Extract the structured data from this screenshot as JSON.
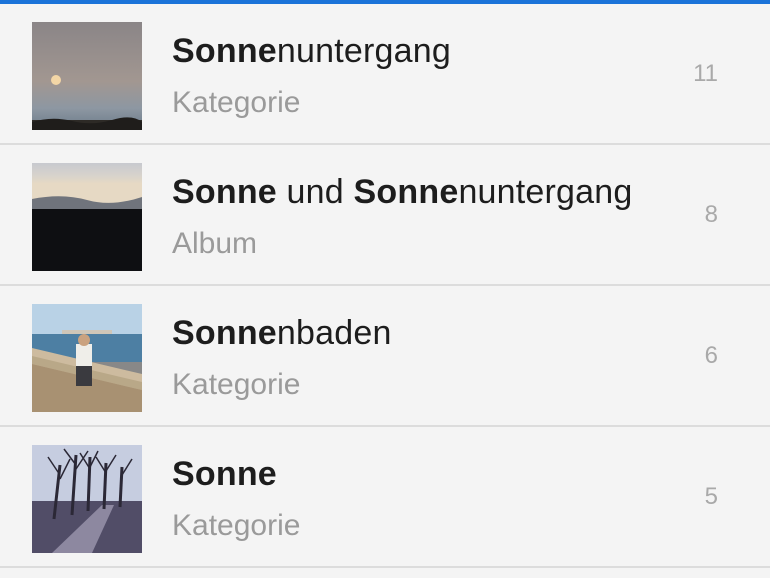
{
  "results": [
    {
      "title_parts": [
        {
          "text": "Sonne",
          "bold": true
        },
        {
          "text": "nuntergang",
          "bold": false
        }
      ],
      "subtitle": "Kategorie",
      "count": "11",
      "thumbnail": "sunset-moon-photo"
    },
    {
      "title_parts": [
        {
          "text": "Sonne",
          "bold": true
        },
        {
          "text": " und ",
          "bold": false
        },
        {
          "text": "Sonne",
          "bold": true
        },
        {
          "text": "nuntergang",
          "bold": false
        }
      ],
      "subtitle": "Album",
      "count": "8",
      "thumbnail": "dusk-landscape-photo"
    },
    {
      "title_parts": [
        {
          "text": "Sonne",
          "bold": true
        },
        {
          "text": "nbaden",
          "bold": false
        }
      ],
      "subtitle": "Kategorie",
      "count": "6",
      "thumbnail": "seaside-person-photo"
    },
    {
      "title_parts": [
        {
          "text": "Sonne",
          "bold": true
        }
      ],
      "subtitle": "Kategorie",
      "count": "5",
      "thumbnail": "tree-road-photo"
    }
  ],
  "colors": {
    "accent": "#1a73d9",
    "title": "#1d1d1d",
    "subtitle": "#9a9a9a",
    "count": "#a9a9a9",
    "background": "#f4f4f4",
    "divider": "#dcdcdc"
  }
}
